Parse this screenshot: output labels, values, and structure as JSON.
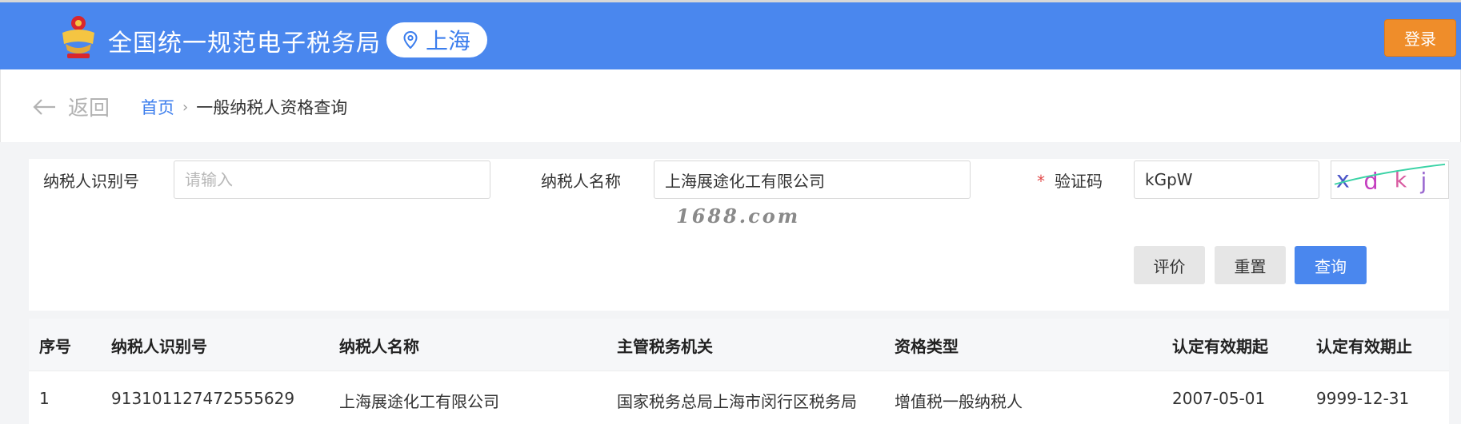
{
  "header": {
    "site_title": "全国统一规范电子税务局",
    "region": "上海",
    "login_label": "登录"
  },
  "nav": {
    "back_label": "返回",
    "breadcrumb_home": "首页",
    "breadcrumb_separator": "›",
    "breadcrumb_current": "一般纳税人资格查询"
  },
  "form": {
    "taxpayer_id_label": "纳税人识别号",
    "taxpayer_id_value": "",
    "taxpayer_id_placeholder": "请输入",
    "taxpayer_name_label": "纳税人名称",
    "taxpayer_name_value": "上海展途化工有限公司",
    "captcha_label": "验证码",
    "captcha_required_mark": "*",
    "captcha_value": "kGpW",
    "captcha_image_text": "xdkj",
    "buttons": {
      "evaluate": "评价",
      "reset": "重置",
      "query": "查询"
    }
  },
  "watermark": "1688.com",
  "table": {
    "columns": [
      "序号",
      "纳税人识别号",
      "纳税人名称",
      "主管税务机关",
      "资格类型",
      "认定有效期起",
      "认定有效期止"
    ],
    "rows": [
      [
        "1",
        "913101127472555629",
        "上海展途化工有限公司",
        "国家税务总局上海市闵行区税务局",
        "增值税一般纳税人",
        "2007-05-01",
        "9999-12-31"
      ]
    ]
  },
  "colors": {
    "brand_blue": "#4a87ee",
    "login_orange": "#ef8d2a",
    "required_red": "#e24b4b"
  }
}
